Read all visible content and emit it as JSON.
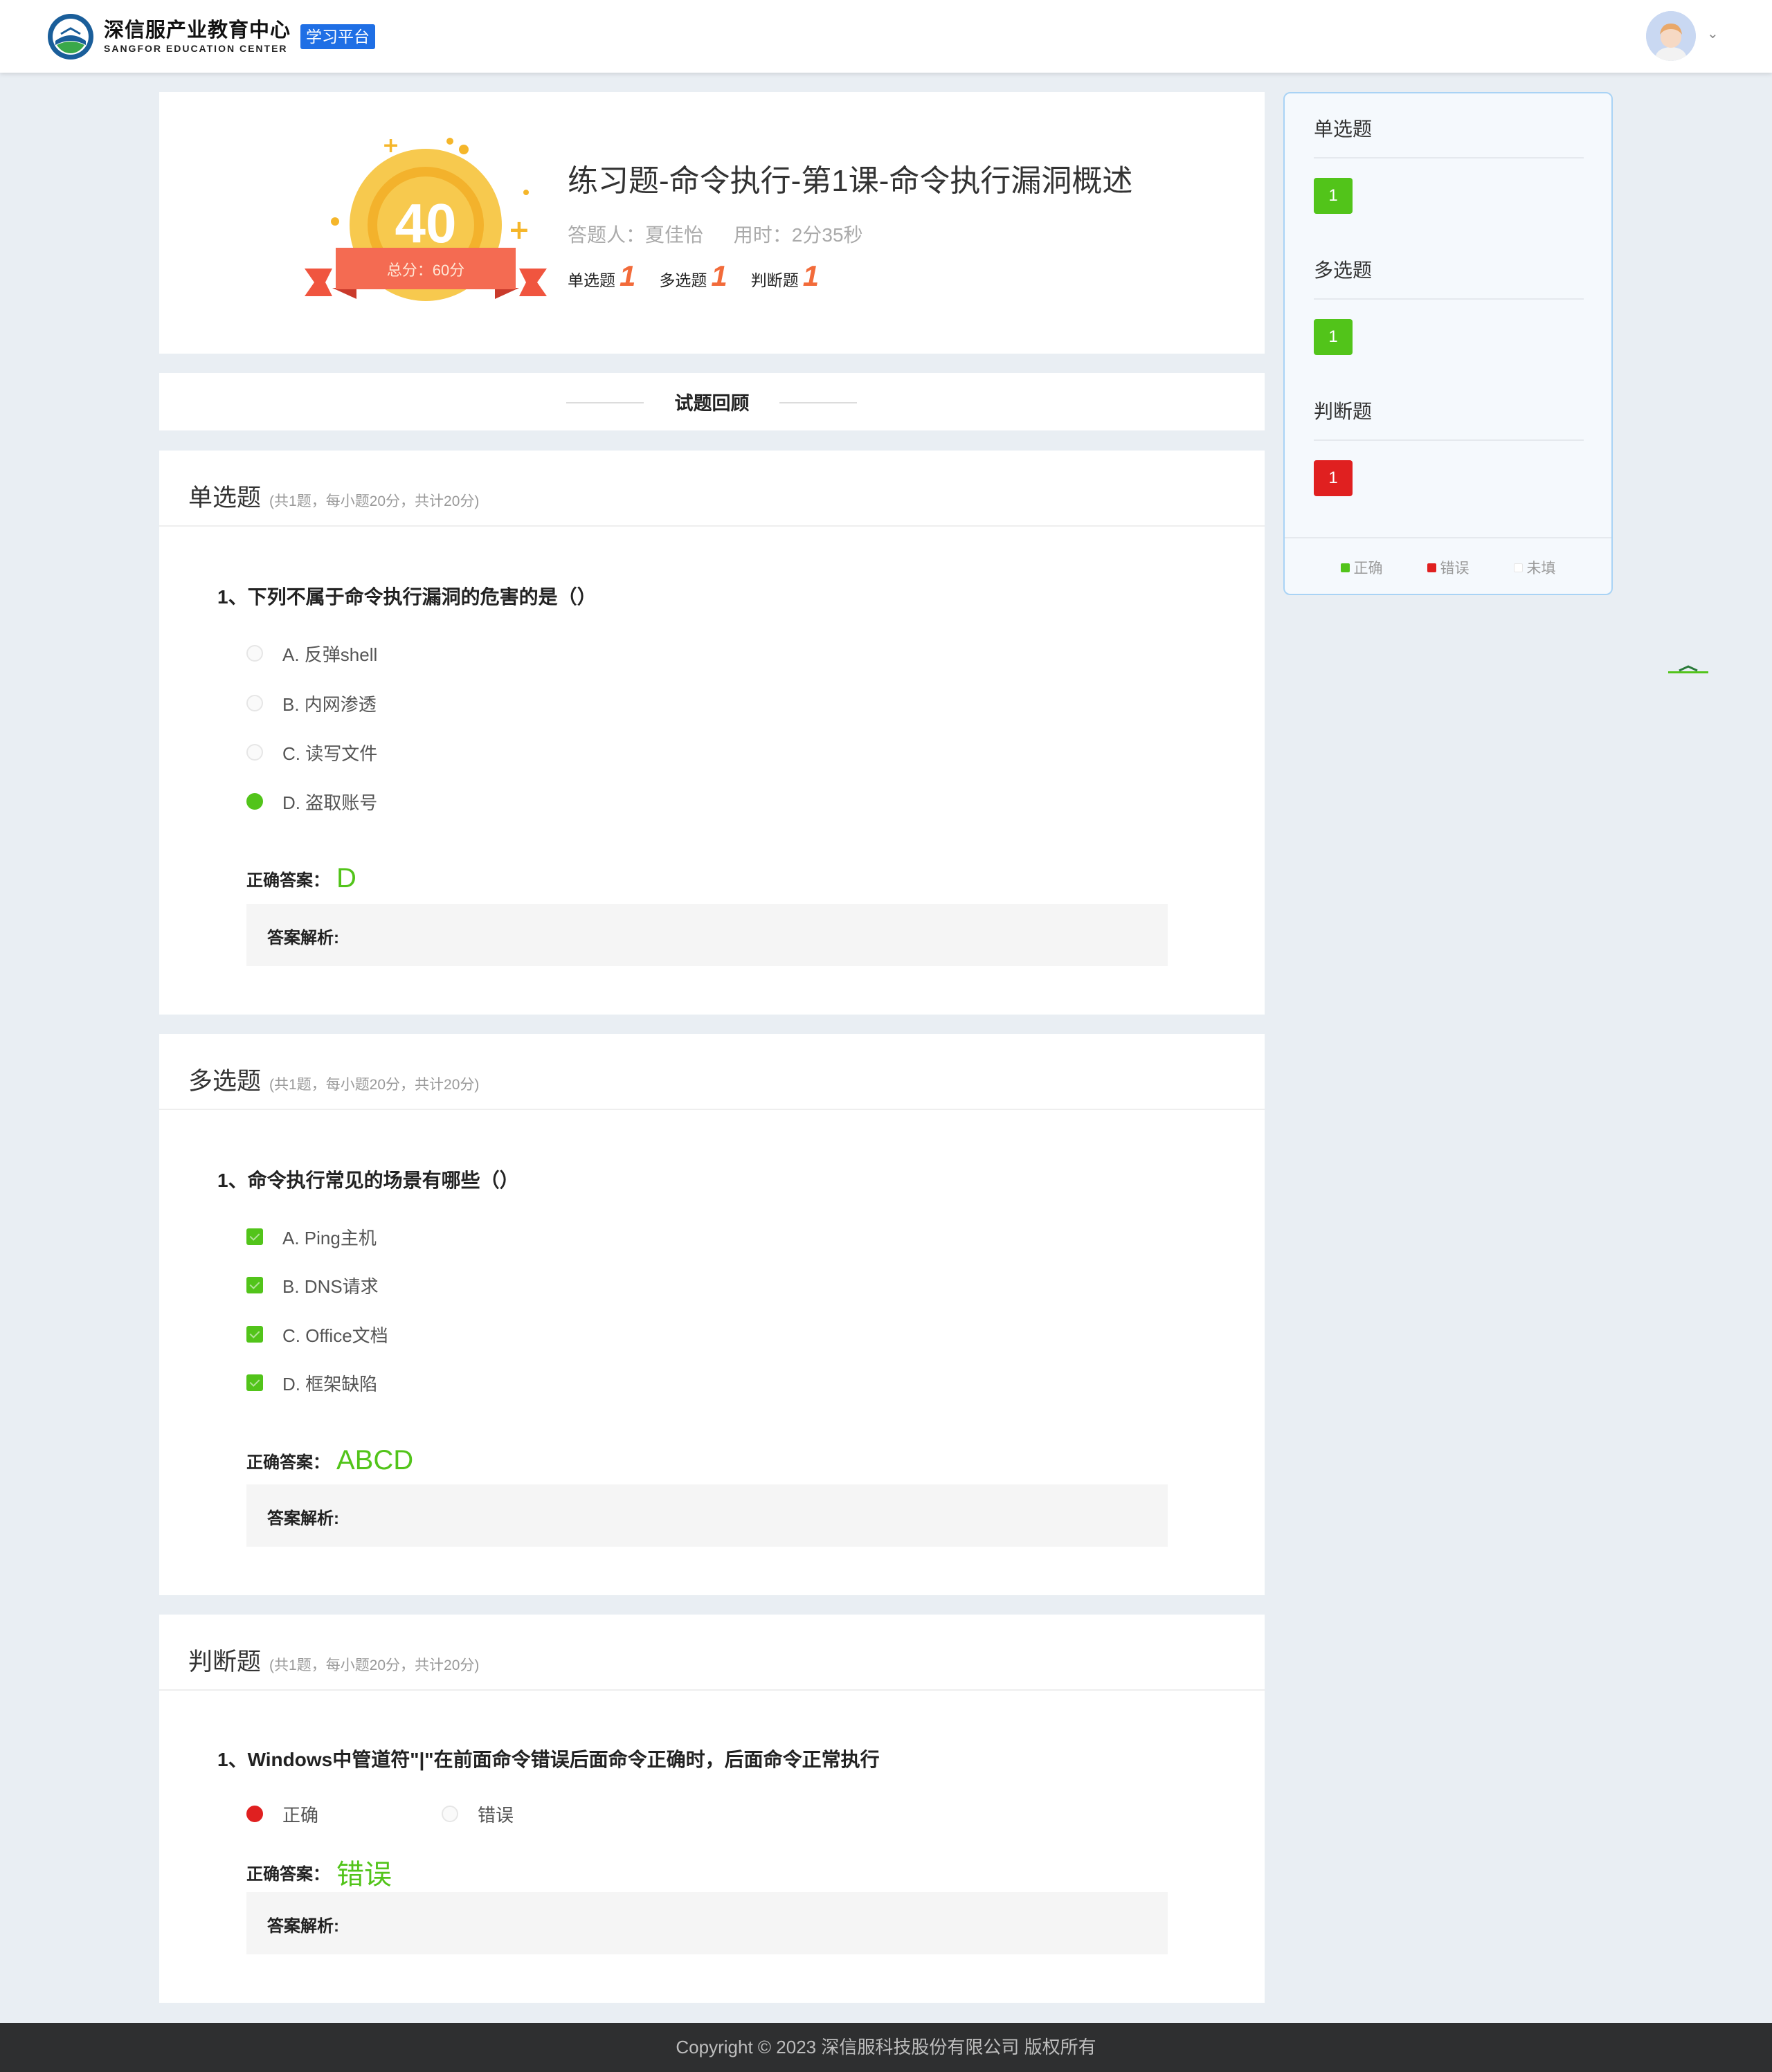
{
  "header": {
    "logo_cn": "深信服产业教育中心",
    "logo_en": "SANGFOR EDUCATION CENTER",
    "platform_tag": "学习平台"
  },
  "result": {
    "score": "40",
    "total_label": "总分：60分",
    "title": "练习题-命令执行-第1课-命令执行漏洞概述",
    "answerer": "答题人：夏佳怡",
    "duration": "用时：2分35秒",
    "type_counts": [
      {
        "label": "单选题",
        "count": "1"
      },
      {
        "label": "多选题",
        "count": "1"
      },
      {
        "label": "判断题",
        "count": "1"
      }
    ]
  },
  "review_title": "试题回顾",
  "sections": {
    "single": {
      "title": "单选题",
      "note": "(共1题，每小题20分，共计20分)",
      "question": "1、下列不属于命令执行漏洞的危害的是（）",
      "options": [
        "A. 反弹shell",
        "B. 内网渗透",
        "C. 读写文件",
        "D. 盗取账号"
      ],
      "selected": "D",
      "answer_label": "正确答案：",
      "answer": "D",
      "analysis_label": "答案解析:"
    },
    "multiple": {
      "title": "多选题",
      "note": "(共1题，每小题20分，共计20分)",
      "question": "1、命令执行常见的场景有哪些（）",
      "options": [
        "A. Ping主机",
        "B. DNS请求",
        "C. Office文档",
        "D. 框架缺陷"
      ],
      "selected": [
        "A",
        "B",
        "C",
        "D"
      ],
      "answer_label": "正确答案：",
      "answer": "ABCD",
      "analysis_label": "答案解析:"
    },
    "judge": {
      "title": "判断题",
      "note": "(共1题，每小题20分，共计20分)",
      "question": "1、Windows中管道符\"|\"在前面命令错误后面命令正确时，后面命令正常执行",
      "options": [
        "正确",
        "错误"
      ],
      "selected": "正确",
      "answer_label": "正确答案：",
      "answer": "错误",
      "analysis_label": "答案解析:"
    }
  },
  "sidebar": {
    "groups": [
      {
        "title": "单选题",
        "items": [
          {
            "num": "1",
            "status": "correct"
          }
        ]
      },
      {
        "title": "多选题",
        "items": [
          {
            "num": "1",
            "status": "correct"
          }
        ]
      },
      {
        "title": "判断题",
        "items": [
          {
            "num": "1",
            "status": "wrong"
          }
        ]
      }
    ],
    "legend": [
      {
        "label": "正确",
        "color": "#52c41a"
      },
      {
        "label": "错误",
        "color": "#e02020"
      },
      {
        "label": "未填",
        "color": "#ffffff"
      }
    ]
  },
  "colors": {
    "correct": "#52c41a",
    "wrong": "#e02020",
    "brand": "#1f6fe5",
    "count_accent": "#f26b3a"
  },
  "footer": "Copyright © 2023 深信服科技股份有限公司 版权所有"
}
